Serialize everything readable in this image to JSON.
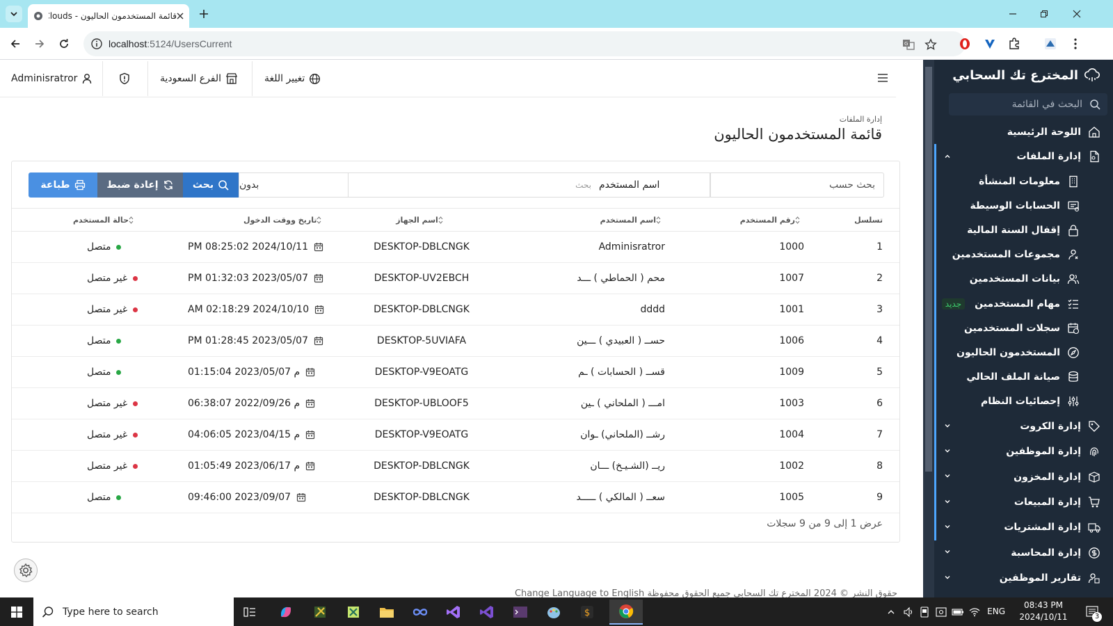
{
  "browser": {
    "tab_title": "قائمة المستخدمون الحاليون - Tech Clouds",
    "url_host": "localhost",
    "url_path": ":5124/UsersCurrent"
  },
  "topbar": {
    "user": "Adminisratror",
    "branch": "الفرع السعودية",
    "language": "تغيير اللغة"
  },
  "sidebar": {
    "brand": "المخترع تك السحابي",
    "search_placeholder": "البحث في القائمة",
    "items": [
      {
        "label": "اللوحة الرئيسية",
        "icon": "home-icon"
      },
      {
        "label": "إدارة الملفات",
        "icon": "file-icon",
        "expanded": true
      },
      {
        "label": "معلومات المنشأة",
        "icon": "building-icon",
        "sub": true
      },
      {
        "label": "الحسابات الوسيطة",
        "icon": "receipt-icon",
        "sub": true
      },
      {
        "label": "إقفال السنة المالية",
        "icon": "lock-icon",
        "sub": true
      },
      {
        "label": "مجموعات المستخدمين",
        "icon": "user-group-icon",
        "sub": true
      },
      {
        "label": "بيانات المستخدمين",
        "icon": "users-icon",
        "sub": true
      },
      {
        "label": "مهام المستخدمين",
        "icon": "list-icon",
        "sub": true,
        "badge": "جديد"
      },
      {
        "label": "سجلات المستخدمين",
        "icon": "calendar-clock-icon",
        "sub": true
      },
      {
        "label": "المستخدمون الحاليون",
        "icon": "compass-icon",
        "sub": true
      },
      {
        "label": "صيانة الملف الحالي",
        "icon": "database-icon",
        "sub": true
      },
      {
        "label": "إحصائيات النظام",
        "icon": "sliders-icon",
        "sub": true
      },
      {
        "label": "إدارة الكروت",
        "icon": "tag-icon"
      },
      {
        "label": "إدارة الموظفين",
        "icon": "fingerprint-icon"
      },
      {
        "label": "إدارة المخزون",
        "icon": "box-icon"
      },
      {
        "label": "إدارة المبيعات",
        "icon": "cart-icon"
      },
      {
        "label": "إدارة المشتريات",
        "icon": "truck-icon"
      },
      {
        "label": "إدارة المحاسبة",
        "icon": "coin-icon"
      },
      {
        "label": "تقارير الموظفين",
        "icon": "person-report-icon"
      }
    ]
  },
  "page": {
    "breadcrumb": "إدارة الملفات",
    "title": "قائمة المستخدمون الحاليون"
  },
  "filters": {
    "search_by_label": "بحث حسب",
    "field": "اسم المستخدم",
    "search_placeholder": "بحث",
    "none": "بدون",
    "search_btn": "بحث",
    "reset_btn": "إعادة ضبط",
    "print_btn": "طباعة"
  },
  "table": {
    "columns": [
      "تسلسل",
      "رقم المستخدم",
      "اسم المستخدم",
      "اسم الجهاز",
      "تاريخ ووقت الدخول",
      "حالة المستخدم"
    ],
    "rows": [
      {
        "seq": "1",
        "user_no": "1000",
        "user_name": "Adminisratror",
        "device": "DESKTOP-DBLCNGK",
        "login": "PM 08:25:02 2024/10/11",
        "status": "متصل",
        "online": true
      },
      {
        "seq": "2",
        "user_no": "1007",
        "user_name": "محم ( الحماطي ) ـــد",
        "device": "DESKTOP-UV2EBCH",
        "login": "PM 01:32:03 2023/05/07",
        "status": "غير متصل",
        "online": false
      },
      {
        "seq": "3",
        "user_no": "1001",
        "user_name": "dddd",
        "device": "DESKTOP-DBLCNGK",
        "login": "AM 02:18:29 2024/10/10",
        "status": "غير متصل",
        "online": false
      },
      {
        "seq": "4",
        "user_no": "1006",
        "user_name": "حســ ( العبيدي ) ـــين",
        "device": "DESKTOP-5UVIAFA",
        "login": "PM 01:28:45 2023/05/07",
        "status": "متصل",
        "online": true
      },
      {
        "seq": "5",
        "user_no": "1009",
        "user_name": "قســ ( الحسابات ) ـم",
        "device": "DESKTOP-V9EOATG",
        "login": "01:15:04 2023/05/07 م",
        "status": "متصل",
        "online": true
      },
      {
        "seq": "6",
        "user_no": "1003",
        "user_name": "امـــ ( الملحاني ) ـين",
        "device": "DESKTOP-UBLOOF5",
        "login": "06:38:07 2022/09/26 م",
        "status": "غير متصل",
        "online": false
      },
      {
        "seq": "7",
        "user_no": "1004",
        "user_name": "رشــ (الملحاني) ـوان",
        "device": "DESKTOP-V9EOATG",
        "login": "04:06:05 2023/04/15 م",
        "status": "غير متصل",
        "online": false
      },
      {
        "seq": "8",
        "user_no": "1002",
        "user_name": "ريــ (الشـيـخ) ـــان",
        "device": "DESKTOP-DBLCNGK",
        "login": "01:05:49 2023/06/17 م",
        "status": "غير متصل",
        "online": false
      },
      {
        "seq": "9",
        "user_no": "1005",
        "user_name": "سعــ ( المالكي ) ـــــد",
        "device": "DESKTOP-DBLCNGK",
        "login": "09:46:00 2023/09/07",
        "status": "متصل",
        "online": true
      }
    ],
    "summary": "عرض 1 إلى 9 من 9 سجلات"
  },
  "footer": {
    "text": "حقوق النشر © 2024 المخترع تك السحابي   جميع الحقوق محفوظة   Change Language to English"
  },
  "taskbar": {
    "search_placeholder": "Type here to search",
    "lang": "ENG",
    "time": "08:43 PM",
    "date": "2024/10/11",
    "notifications": "3"
  },
  "colors": {
    "sidebar_bg": "#1e2a38",
    "online": "#28a745",
    "offline": "#dc3545",
    "primary": "#2f75c8"
  }
}
